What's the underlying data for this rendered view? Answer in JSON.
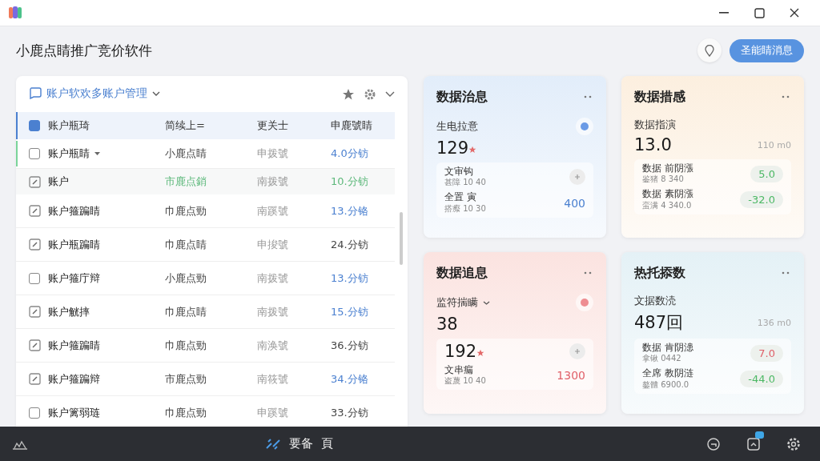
{
  "app": {
    "title": "小鹿点睛推广竞价软件",
    "action_button": "圣能睛消息"
  },
  "panel": {
    "tab": "账户软欢多账户管理",
    "columns": [
      "账户瓶琦",
      "简续上=",
      "更关士",
      "申鹿號睛"
    ],
    "rows": [
      {
        "kind": "checkbox",
        "name": "账户瓶睛",
        "menu": true,
        "flagged": true,
        "selected": false,
        "col2": "小鹿点睛",
        "col3": "申拨號",
        "col4": "4.0分钫",
        "highlight": true
      },
      {
        "kind": "edit",
        "name": "账户",
        "menu": false,
        "flagged": false,
        "selected": true,
        "col2": "市鹿点銷",
        "col3": "南拨號",
        "col4": "10.分钫",
        "highlight": true
      },
      {
        "kind": "edit",
        "name": "账户箍蹁睛",
        "menu": false,
        "flagged": false,
        "selected": false,
        "col2": "巾鹿点勁",
        "col3": "南蹊號",
        "col4": "13.分铬",
        "highlight": true
      },
      {
        "kind": "edit",
        "name": "账户瓶蹁睛",
        "menu": false,
        "flagged": false,
        "selected": false,
        "col2": "巾鹿点睛",
        "col3": "申捘號",
        "col4": "24.分钫",
        "highlight": false
      },
      {
        "kind": "checkbox",
        "name": "账户箍庁辩",
        "menu": false,
        "flagged": false,
        "selected": false,
        "col2": "小鹿点勁",
        "col3": "南拨號",
        "col4": "13.分钫",
        "highlight": true
      },
      {
        "kind": "edit",
        "name": "账户觥摔",
        "menu": false,
        "flagged": false,
        "selected": false,
        "col2": "巾鹿点睛",
        "col3": "南拨號",
        "col4": "15.分钫",
        "highlight": true
      },
      {
        "kind": "edit",
        "name": "账户箍蹁睛",
        "menu": false,
        "flagged": false,
        "selected": false,
        "col2": "巾鹿点勁",
        "col3": "南涣號",
        "col4": "36.分钫",
        "highlight": false
      },
      {
        "kind": "edit",
        "name": "账户箍蹁辩",
        "menu": false,
        "flagged": false,
        "selected": false,
        "col2": "市鹿点勁",
        "col3": "南筱號",
        "col4": "34.分铬",
        "highlight": true
      },
      {
        "kind": "checkbox",
        "name": "账户篱弱琏",
        "menu": false,
        "flagged": false,
        "selected": false,
        "col2": "巾鹿点勁",
        "col3": "申蹊號",
        "col4": "33.分钫",
        "highlight": false
      }
    ]
  },
  "cards": [
    {
      "title": "数据治息",
      "color": "#e2edfa",
      "label": "生电拉意",
      "dropdown": false,
      "value": "129",
      "star": true,
      "indicator": {
        "color": "#6b9be6"
      },
      "add_button": true,
      "rows": [
        {
          "name": "文审钩",
          "meta": "甚障 10 40"
        },
        {
          "name": "全置 寅",
          "meta": "搭瘵 10 30",
          "kind": "plain",
          "color": "#4b80d0",
          "value": "400"
        }
      ]
    },
    {
      "title": "数据措感",
      "color": "#fcefdf",
      "label": "数据指演",
      "dropdown": false,
      "value": "13.0",
      "star": false,
      "aside": "110 m0",
      "add_button": false,
      "rows": [
        {
          "name": "数据 前阴漲",
          "meta": "鉴猪 8 340",
          "kind": "pill",
          "color": "#4cb864",
          "value": "5.0"
        },
        {
          "name": "数据 素阴漲",
          "meta": "蛮满 4 340.0",
          "kind": "pill",
          "color": "#4cb864",
          "value": "-32.0"
        }
      ]
    },
    {
      "title": "数据追息",
      "color": "#fbe3e0",
      "label": "监符揣瞒",
      "dropdown": true,
      "value": "38",
      "star": false,
      "indicator": {
        "color": "#ee8d92"
      },
      "second": "192",
      "add_button": true,
      "rows": [
        {
          "name": "文串瘺",
          "meta": "盗蔑 10 40",
          "kind": "plain",
          "color": "#e05f68",
          "value": "1300"
        }
      ]
    },
    {
      "title": "热托掭数",
      "color": "#e4f1f6",
      "label": "文据数涜",
      "dropdown": false,
      "value": "487回",
      "star": false,
      "aside": "136 m0",
      "add_button": false,
      "rows": [
        {
          "name": "数据 肯阴漶",
          "meta": "拿锹 0442",
          "kind": "pill",
          "color": "#e05f68",
          "value": "7.0"
        },
        {
          "name": "全席 教阴涟",
          "meta": "鏊體 6900.0",
          "kind": "pill",
          "color": "#4cb864",
          "value": "-44.0"
        }
      ]
    }
  ],
  "bottom_bar": {
    "label": "要备",
    "label_2": "頁",
    "badge": true
  }
}
